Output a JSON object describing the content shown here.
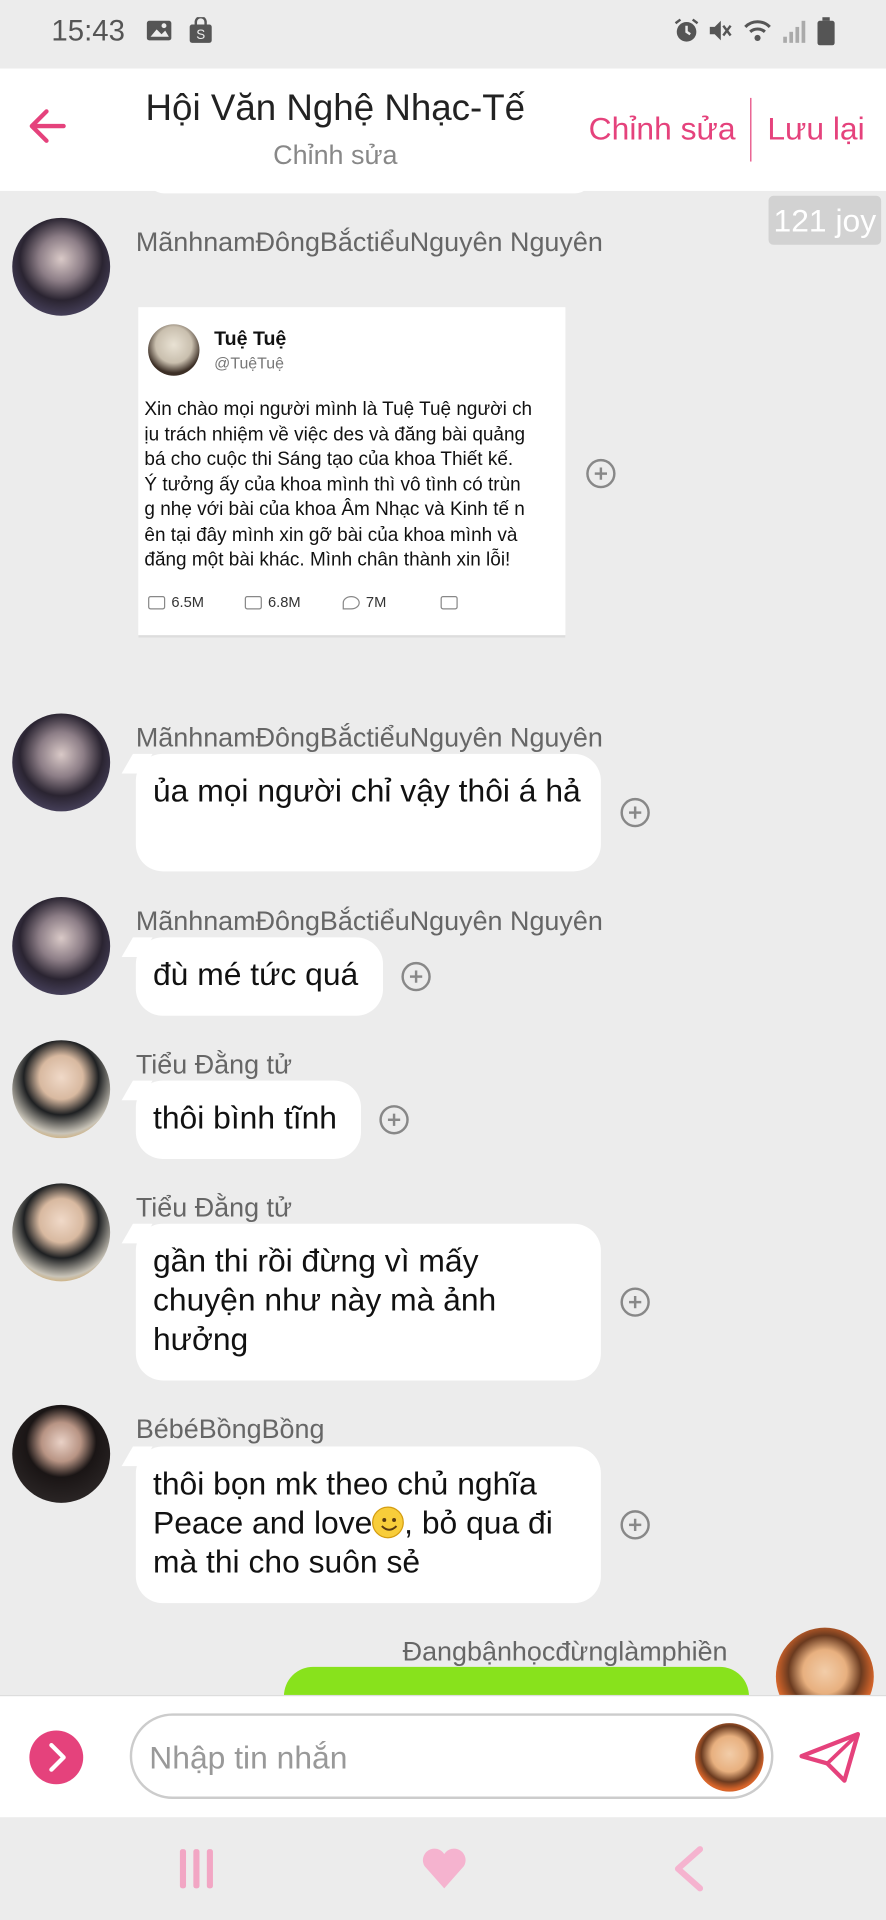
{
  "status_bar": {
    "time": "15:43"
  },
  "header": {
    "title": "Hội Văn Nghệ Nhạc-Tế",
    "subtitle": "Chỉnh sửa",
    "edit_label": "Chỉnh sửa",
    "save_label": "Lưu lại"
  },
  "joy_badge": "121 joy",
  "tweet": {
    "name": "Tuệ Tuệ",
    "handle": "@TuệTuệ",
    "body": "Xin chào mọi người mình là Tuệ Tuệ người ch\nịu trách nhiệm về việc des và đăng bài quảng\nbá cho cuộc thi Sáng tạo của khoa Thiết kế.\nÝ tưởng ấy của khoa mình thì vô tình có trùn\ng nhẹ với bài của khoa Âm Nhạc và Kinh tế n\nên tại đây mình xin gỡ bài của khoa mình và\nđăng một bài khác. Mình chân thành xin lỗi!",
    "replies": "6.5M",
    "retweets": "6.8M",
    "likes": "7M"
  },
  "messages": [
    {
      "sender": "MãnhnamĐôngBắctiểuNguyên Nguyên",
      "text": ""
    },
    {
      "sender": "MãnhnamĐôngBắctiểuNguyên Nguyên",
      "text": "ủa mọi người chỉ vậy thôi á hả"
    },
    {
      "sender": "MãnhnamĐôngBắctiểuNguyên Nguyên",
      "text": "đù mé tức quá"
    },
    {
      "sender": "Tiểu Đằng tử",
      "text": "thôi bình tĩnh"
    },
    {
      "sender": "Tiểu Đằng tử",
      "text": "gần thi rồi đừng vì mấy chuyện như này mà ảnh hưởng"
    },
    {
      "sender": "BébéBồngBồng",
      "text_before": "thôi bọn mk theo chủ nghĩa Peace and love",
      "text_after": ", bỏ qua đi mà thi cho suôn sẻ"
    },
    {
      "sender": "Đangbậnhọcđừnglàmphiền",
      "text": ""
    }
  ],
  "input": {
    "placeholder": "Nhập tin nhắn"
  },
  "colors": {
    "accent": "#e5427c",
    "own_bubble": "#88e21c",
    "background": "#ececec"
  }
}
